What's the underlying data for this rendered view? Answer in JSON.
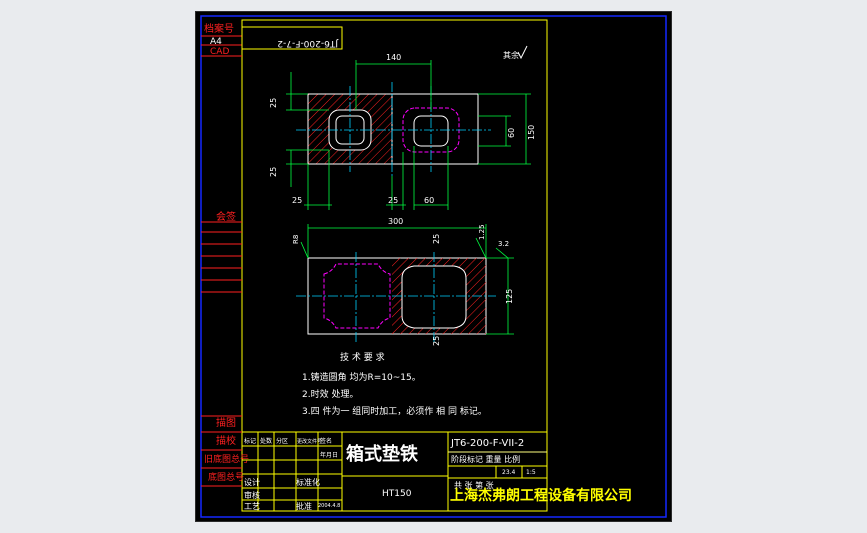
{
  "colors": {
    "background": "#000000",
    "frame_blue": "#1428ff",
    "frame_yellow": "#ffff00",
    "red": "#ff2020",
    "green": "#00ff40",
    "cyan": "#00d0ff",
    "magenta": "#ff00ff",
    "white": "#ffffff"
  },
  "left_margin": {
    "archive_no": "档案号",
    "size": "A4",
    "cad": "CAD",
    "signature": "会签",
    "check_drawing": "描图",
    "check_proof": "描校",
    "old_base_no": "旧底图总号",
    "base_no": "底图总号"
  },
  "top_code": "JT6-200-F-7-2",
  "roughness_note": "其余",
  "dims": {
    "top_width": "140",
    "left_25_top": "25",
    "left_25_bottom": "25",
    "bottom_25_a": "25",
    "bottom_25_b": "25",
    "bottom_60": "60",
    "right_60": "60",
    "right_150": "150",
    "front_300": "300",
    "front_25_top": "25",
    "front_25_bottom": "25",
    "right_125": "125",
    "left_r": "R8",
    "chamfer": "1.25",
    "right_r": "3.2"
  },
  "notes": {
    "title": "技 术 要 求",
    "items": [
      "1.铸造圆角 均为R=10~15。",
      "2.时效 处理。",
      "3.四 件为一 组同时加工，必须作 相 同 标记。"
    ]
  },
  "title_block": {
    "part_name": "箱式垫铁",
    "drawing_no": "JT6-200-F-VII-2",
    "stage_row": "阶段标记 重量 比例",
    "weight": "23.4",
    "scale": "1:5",
    "sheet": "共 张 第 张",
    "material": "HT150",
    "company": "上海杰弗朗工程设备有限公司",
    "sign_rows": [
      [
        "标记",
        "处数",
        "分区",
        "更改文件号",
        "签名",
        "年月日"
      ],
      [
        "设计",
        "",
        "标准化",
        "",
        "",
        ""
      ],
      [
        "审核",
        "",
        "",
        "",
        "",
        ""
      ],
      [
        "工艺",
        "",
        "批准",
        "",
        "",
        ""
      ]
    ],
    "date": "2004.4.8"
  }
}
